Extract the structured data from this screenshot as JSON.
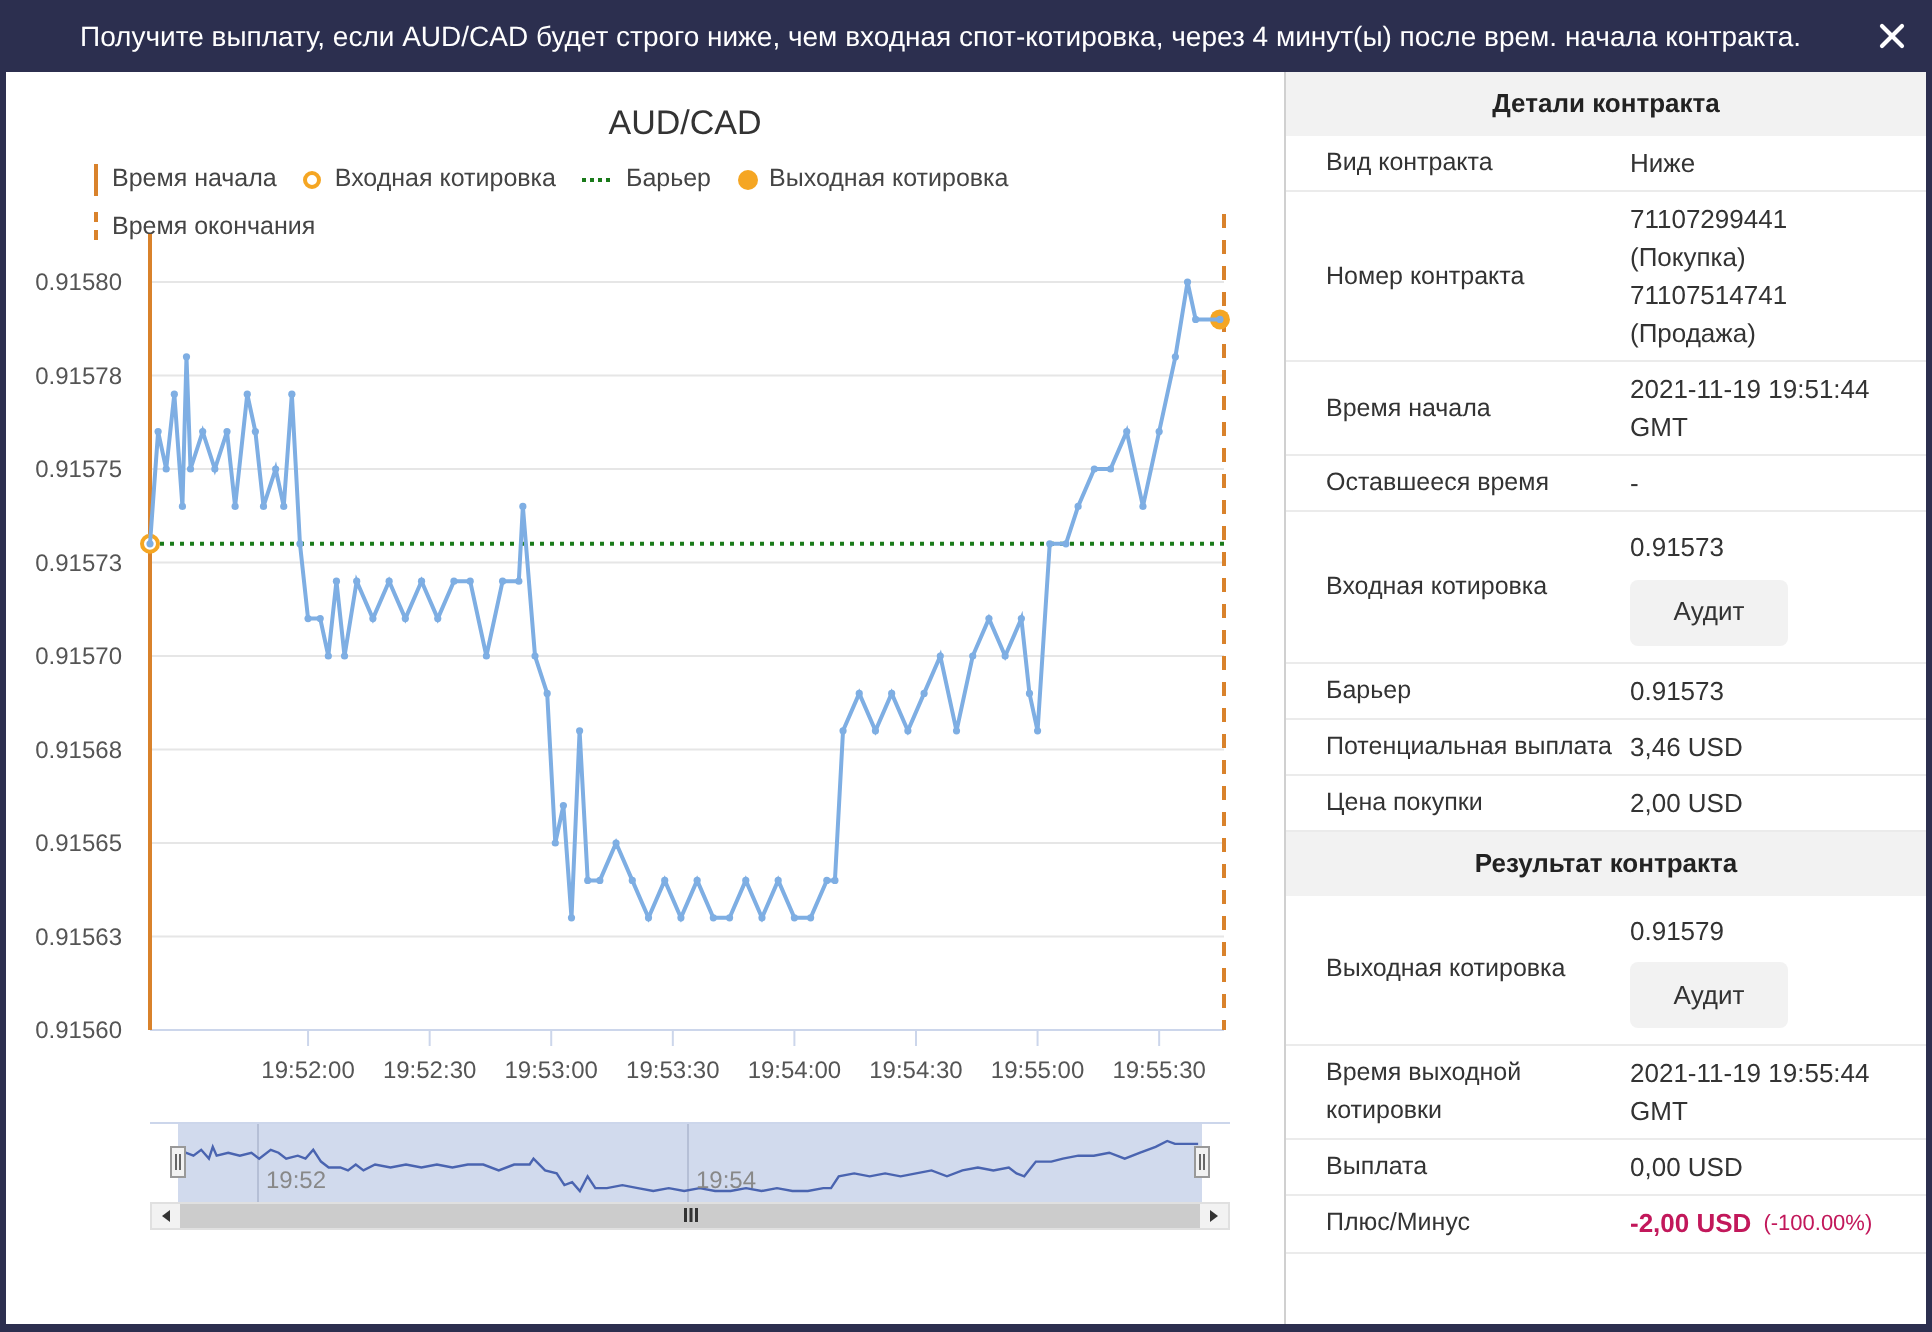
{
  "header": {
    "title": "Получите выплату, если AUD/CAD будет строго ниже, чем входная спот-котировка, через 4 минут(ы) после врем. начала контракта."
  },
  "chart": {
    "legend": [
      {
        "kind": "start_line",
        "label": "Время начала"
      },
      {
        "kind": "entry_point",
        "label": "Входная котировка"
      },
      {
        "kind": "barrier_line",
        "label": "Барьер"
      },
      {
        "kind": "exit_point",
        "label": "Выходная котировка"
      },
      {
        "kind": "end_line",
        "label": "Время окончания"
      }
    ],
    "chart_data": {
      "type": "line",
      "title": "AUD/CAD",
      "grid": true,
      "xlim": [
        71481,
        71746
      ],
      "ylim": [
        0.9156,
        0.9158
      ],
      "ref_lines": [
        {
          "axis": "y",
          "value": 0.91573,
          "color": "#1a7a1a"
        }
      ],
      "yticks": [
        {
          "value": 0.9156,
          "label": "0.91560"
        },
        {
          "value": 0.915625,
          "label": "0.91563"
        },
        {
          "value": 0.91565,
          "label": "0.91565"
        },
        {
          "value": 0.915675,
          "label": "0.91568"
        },
        {
          "value": 0.9157,
          "label": "0.91570"
        },
        {
          "value": 0.915725,
          "label": "0.91573"
        },
        {
          "value": 0.91575,
          "label": "0.91575"
        },
        {
          "value": 0.915775,
          "label": "0.91578"
        },
        {
          "value": 0.9158,
          "label": "0.91580"
        }
      ],
      "xticks": [
        {
          "value": 71520,
          "label": "19:52:00"
        },
        {
          "value": 71550,
          "label": "19:52:30"
        },
        {
          "value": 71580,
          "label": "19:53:00"
        },
        {
          "value": 71610,
          "label": "19:53:30"
        },
        {
          "value": 71640,
          "label": "19:54:00"
        },
        {
          "value": 71670,
          "label": "19:54:30"
        },
        {
          "value": 71700,
          "label": "19:55:00"
        },
        {
          "value": 71730,
          "label": "19:55:30"
        }
      ],
      "x": [
        71481,
        71483,
        71485,
        71487,
        71489,
        71490,
        71491,
        71494,
        71497,
        71500,
        71502,
        71505,
        71507,
        71509,
        71512,
        71514,
        71516,
        71518,
        71520,
        71523,
        71525,
        71527,
        71529,
        71532,
        71536,
        71540,
        71544,
        71548,
        71552,
        71556,
        71560,
        71564,
        71568,
        71572,
        71573,
        71576,
        71579,
        71581,
        71583,
        71585,
        71587,
        71589,
        71592,
        71596,
        71600,
        71604,
        71608,
        71612,
        71616,
        71620,
        71624,
        71628,
        71632,
        71636,
        71640,
        71644,
        71648,
        71650,
        71652,
        71656,
        71660,
        71664,
        71668,
        71672,
        71676,
        71680,
        71684,
        71688,
        71692,
        71696,
        71698,
        71700,
        71703,
        71707,
        71710,
        71714,
        71718,
        71722,
        71726,
        71730,
        71734,
        71737,
        71739,
        71745
      ],
      "series": [
        {
          "color": "#7eaee3",
          "marker": "circle",
          "values": [
            0.91573,
            0.91576,
            0.91575,
            0.91577,
            0.91574,
            0.91578,
            0.91575,
            0.91576,
            0.91575,
            0.91576,
            0.91574,
            0.91577,
            0.91576,
            0.91574,
            0.91575,
            0.91574,
            0.91577,
            0.91573,
            0.91571,
            0.91571,
            0.9157,
            0.91572,
            0.9157,
            0.91572,
            0.91571,
            0.91572,
            0.91571,
            0.91572,
            0.91571,
            0.91572,
            0.91572,
            0.9157,
            0.91572,
            0.91572,
            0.91574,
            0.9157,
            0.91569,
            0.91565,
            0.91566,
            0.91563,
            0.91568,
            0.91564,
            0.91564,
            0.91565,
            0.91564,
            0.91563,
            0.91564,
            0.91563,
            0.91564,
            0.91563,
            0.91563,
            0.91564,
            0.91563,
            0.91564,
            0.91563,
            0.91563,
            0.91564,
            0.91564,
            0.91568,
            0.91569,
            0.91568,
            0.91569,
            0.91568,
            0.91569,
            0.9157,
            0.91568,
            0.9157,
            0.91571,
            0.9157,
            0.91571,
            0.91569,
            0.91568,
            0.91573,
            0.91573,
            0.91574,
            0.91575,
            0.91575,
            0.91576,
            0.91574,
            0.91576,
            0.91578,
            0.9158,
            0.91579,
            0.91579
          ]
        },
        {
          "color": "#f5a623",
          "marker": "circle",
          "values": [
            0.91573,
            null,
            null,
            null,
            null,
            null,
            null,
            null,
            null,
            null,
            null,
            null,
            null,
            null,
            null,
            null,
            null,
            null,
            null,
            null,
            null,
            null,
            null,
            null,
            null,
            null,
            null,
            null,
            null,
            null,
            null,
            null,
            null,
            null,
            null,
            null,
            null,
            null,
            null,
            null,
            null,
            null,
            null,
            null,
            null,
            null,
            null,
            null,
            null,
            null,
            null,
            null,
            null,
            null,
            null,
            null,
            null,
            null,
            null,
            null,
            null,
            null,
            null,
            null,
            null,
            null,
            null,
            null,
            null,
            null,
            null,
            null,
            null,
            null,
            null,
            null,
            null,
            null,
            null,
            null,
            null,
            null,
            null,
            null
          ]
        },
        {
          "color": "#f5a623",
          "marker": "circle",
          "values": [
            null,
            null,
            null,
            null,
            null,
            null,
            null,
            null,
            null,
            null,
            null,
            null,
            null,
            null,
            null,
            null,
            null,
            null,
            null,
            null,
            null,
            null,
            null,
            null,
            null,
            null,
            null,
            null,
            null,
            null,
            null,
            null,
            null,
            null,
            null,
            null,
            null,
            null,
            null,
            null,
            null,
            null,
            null,
            null,
            null,
            null,
            null,
            null,
            null,
            null,
            null,
            null,
            null,
            null,
            null,
            null,
            null,
            null,
            null,
            null,
            null,
            null,
            null,
            null,
            null,
            null,
            null,
            null,
            null,
            null,
            null,
            null,
            null,
            null,
            null,
            null,
            null,
            null,
            null,
            null,
            null,
            null,
            null,
            0.91579
          ]
        }
      ]
    },
    "navigator": {
      "labels": [
        "19:52",
        "19:54"
      ]
    }
  },
  "details": {
    "sections": [
      {
        "title": "Детали контракта",
        "rows": [
          {
            "kind": "text",
            "label": "Вид контракта",
            "lines": [
              "Ниже"
            ]
          },
          {
            "kind": "text",
            "label": "Номер контракта",
            "lines": [
              "71107299441",
              "(Покупка)",
              "71107514741",
              "(Продажа)"
            ]
          },
          {
            "kind": "text",
            "label": "Время начала",
            "lines": [
              "2021-11-19 19:51:44",
              "GMT"
            ]
          },
          {
            "kind": "text",
            "label": "Оставшееся время",
            "lines": [
              "-"
            ]
          },
          {
            "kind": "audit",
            "label": "Входная котировка",
            "lines": [
              "0.91573"
            ],
            "button": "Аудит"
          },
          {
            "kind": "text",
            "label": "Барьер",
            "lines": [
              "0.91573"
            ]
          },
          {
            "kind": "text",
            "label": "Потенциальная выплата",
            "lines": [
              "3,46 USD"
            ]
          },
          {
            "kind": "text",
            "label": "Цена покупки",
            "lines": [
              "2,00 USD"
            ]
          }
        ]
      },
      {
        "title": "Результат контракта",
        "rows": [
          {
            "kind": "audit",
            "label": "Выходная котировка",
            "lines": [
              "0.91579"
            ],
            "button": "Аудит"
          },
          {
            "kind": "text",
            "label": "Время выходной котировки",
            "lines": [
              "2021-11-19 19:55:44",
              "GMT"
            ]
          },
          {
            "kind": "text",
            "label": "Выплата",
            "lines": [
              "0,00 USD"
            ]
          },
          {
            "kind": "pnl",
            "label": "Плюс/Минус",
            "lines": [
              "-2,00 USD"
            ],
            "note": "(-100.00%)"
          }
        ]
      }
    ]
  }
}
